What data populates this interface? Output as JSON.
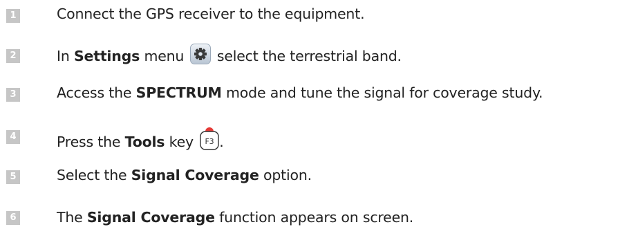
{
  "colors": {
    "badge_bg": "#c6c6c6",
    "badge_text": "#ffffff",
    "text": "#222222",
    "gear_bg": "#cfd8e3",
    "gear_fg": "#3a3a3a",
    "key_dot": "#e53935"
  },
  "steps": [
    {
      "number": "1",
      "text": "Connect the GPS receiver to the equipment."
    },
    {
      "number": "2",
      "pre": "In ",
      "bold": "Settings",
      "mid": " menu ",
      "icon": "gear-icon",
      "post": " select the terrestrial band."
    },
    {
      "number": "3",
      "pre": "Access the ",
      "bold": "SPECTRUM",
      "post": " mode and tune the signal for coverage study."
    },
    {
      "number": "4",
      "pre": "Press the ",
      "bold": "Tools",
      "mid": " key ",
      "icon": "f3-key-icon",
      "key_label": "F3",
      "post": "."
    },
    {
      "number": "5",
      "pre": "Select the ",
      "bold": "Signal Coverage",
      "post": " option."
    },
    {
      "number": "6",
      "pre": "The ",
      "bold": "Signal Coverage",
      "post": " function appears on screen."
    }
  ]
}
